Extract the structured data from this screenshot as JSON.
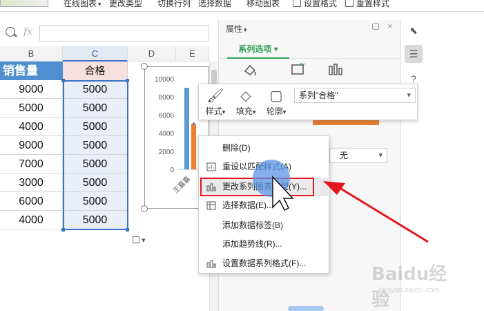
{
  "ribbon": {
    "items": [
      {
        "label": "在线图表",
        "caret": "▾"
      },
      {
        "label": "更改类型"
      },
      {
        "label": "切换行列"
      },
      {
        "label": "选择数据"
      },
      {
        "label": "移动图表"
      },
      {
        "label": "设置格式"
      },
      {
        "label": "重置样式"
      }
    ]
  },
  "formula_bar": {
    "fx": "fx",
    "value": ""
  },
  "sheet": {
    "columns": [
      "B",
      "C",
      "D",
      "E"
    ],
    "header_b": "销售量",
    "header_c": "合格",
    "rows": [
      {
        "b": "9000",
        "c": "5000"
      },
      {
        "b": "5000",
        "c": "5000"
      },
      {
        "b": "4000",
        "c": "5000"
      },
      {
        "b": "9000",
        "c": "5000"
      },
      {
        "b": "7000",
        "c": "5000"
      },
      {
        "b": "3000",
        "c": "5000"
      },
      {
        "b": "6000",
        "c": "5000"
      },
      {
        "b": "4000",
        "c": "5000"
      }
    ]
  },
  "chart_data": {
    "type": "bar",
    "yticks": [
      "10000",
      "8000",
      "6000",
      "4000",
      "2000",
      "0"
    ],
    "ylim": [
      0,
      10000
    ],
    "categories": [
      "王嘉嘉"
    ],
    "series": [
      {
        "values": [
          9000
        ],
        "color": "#5b9bd5"
      },
      {
        "values": [
          5000
        ],
        "color": "#ed7d31"
      }
    ]
  },
  "pane": {
    "title": "属性",
    "title_caret": "▾",
    "close": "×",
    "tab": "系列选项",
    "tab_caret": "▾",
    "dropdown_value": "无"
  },
  "float_toolbar": {
    "style": "样式",
    "fill": "填充",
    "outline": "轮廓",
    "series_select": "系列\"合格\""
  },
  "context_menu": {
    "items": [
      {
        "label": "删除(D)"
      },
      {
        "label": "重设以匹配样式(A)"
      },
      {
        "label": "更改系列图表类型(Y)..."
      },
      {
        "label": "选择数据(E)..."
      },
      {
        "label": "添加数据标签(B)"
      },
      {
        "label": "添加趋势线(R)..."
      },
      {
        "label": "设置数据系列格式(F)..."
      }
    ]
  },
  "watermark": {
    "brand": "Baidu经验",
    "url": "jingyan.baidu.com"
  },
  "colors": {
    "accent_green": "#2f9e55",
    "highlight_red": "#e2161c",
    "header_blue": "#4f8ed0",
    "series_orange": "#ed7d31",
    "series_blue": "#5b9bd5"
  }
}
